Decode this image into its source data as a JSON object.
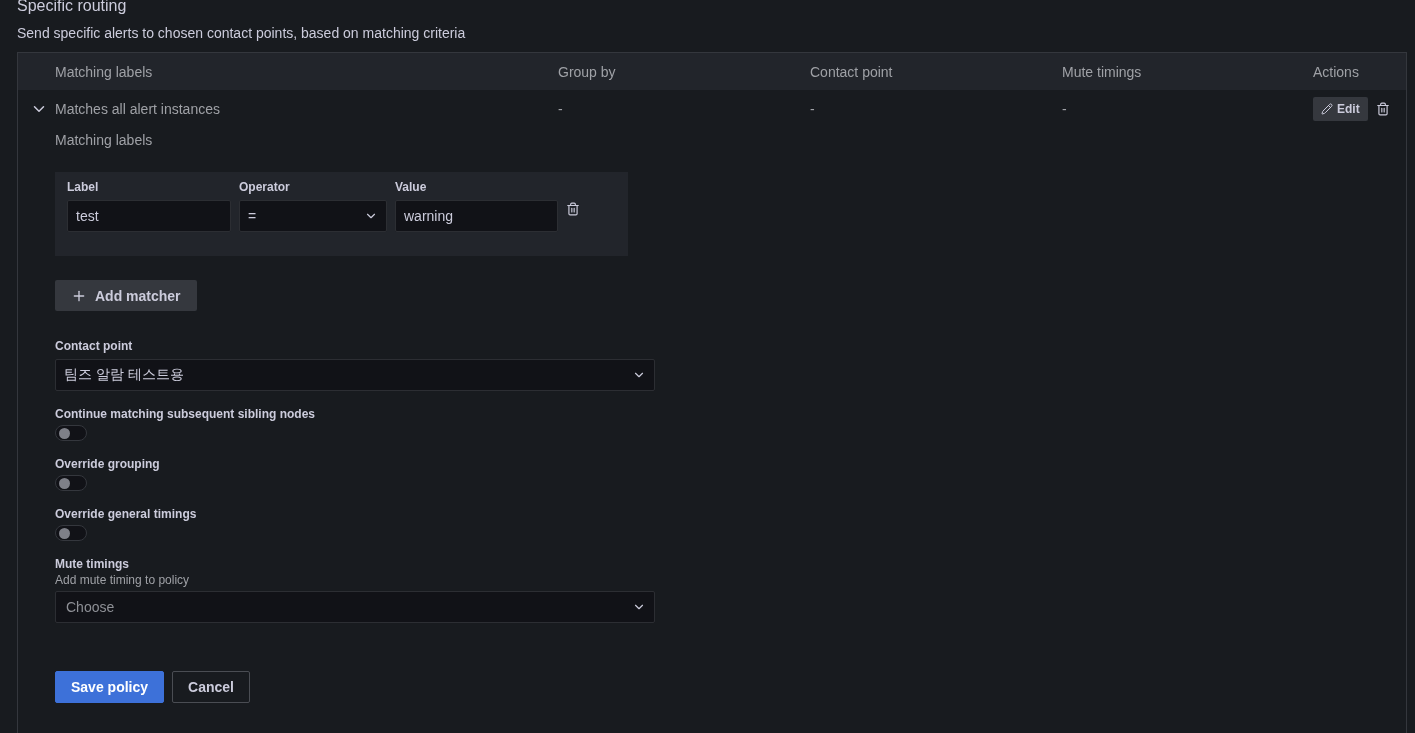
{
  "section": {
    "title": "Specific routing",
    "description": "Send specific alerts to chosen contact points, based on matching criteria"
  },
  "table": {
    "columns": [
      "Matching labels",
      "Group by",
      "Contact point",
      "Mute timings",
      "Actions"
    ],
    "rows": [
      {
        "expanded": true,
        "matching_labels": "Matches all alert instances",
        "group_by": "-",
        "contact_point": "-",
        "mute_timings": "-",
        "edit_label": "Edit"
      }
    ]
  },
  "editor": {
    "matching_labels_title": "Matching labels",
    "matcher_headers": [
      "Label",
      "Operator",
      "Value"
    ],
    "matchers": [
      {
        "label": "test",
        "operator": "=",
        "value": "warning"
      }
    ],
    "add_matcher": "Add matcher",
    "contact_point": {
      "label": "Contact point",
      "value": "팀즈 알람 테스트용"
    },
    "switches": [
      {
        "label": "Continue matching subsequent sibling nodes",
        "on": false
      },
      {
        "label": "Override grouping",
        "on": false
      },
      {
        "label": "Override general timings",
        "on": false
      }
    ],
    "mute_timings": {
      "label": "Mute timings",
      "description": "Add mute timing to policy",
      "placeholder": "Choose"
    },
    "buttons": [
      {
        "label": "Save policy",
        "kind": "primary"
      },
      {
        "label": "Cancel",
        "kind": "secondary"
      }
    ]
  }
}
